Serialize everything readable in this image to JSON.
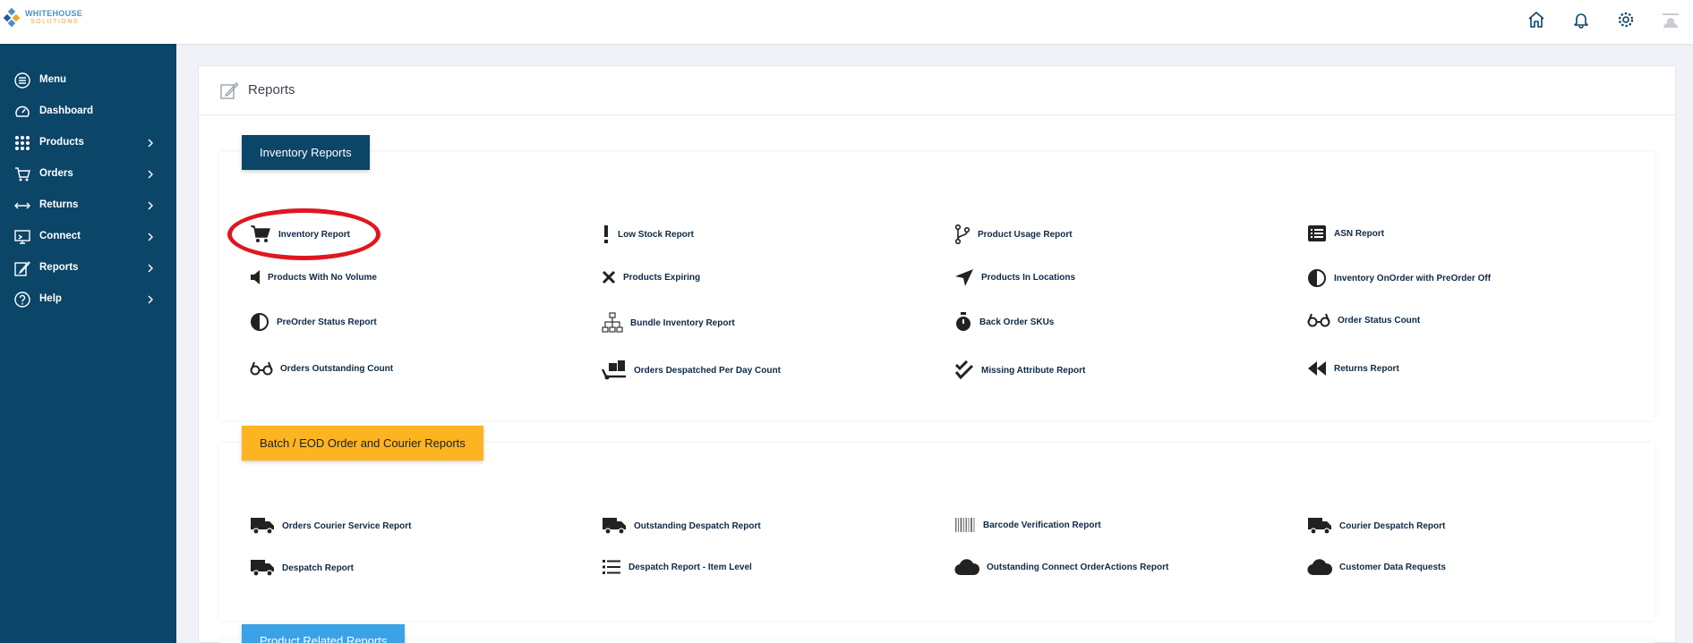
{
  "brand": {
    "name_line1": "WHITEHOUSE",
    "name_line2": "SOLUTIONS"
  },
  "colors": {
    "sidebar": "#0b4568",
    "tab_inventory": "#0b4568",
    "tab_batch": "#fcb420",
    "tab_product": "#3aa3e8",
    "highlight_circle": "#e01620"
  },
  "topbar": {
    "icons": [
      "home-icon",
      "bell-icon",
      "gear-icon",
      "user-avatar"
    ]
  },
  "sidebar": {
    "items": [
      {
        "label": "Menu",
        "icon": "menu-icon",
        "has_chevron": false
      },
      {
        "label": "Dashboard",
        "icon": "dashboard-icon",
        "has_chevron": false
      },
      {
        "label": "Products",
        "icon": "grid-icon",
        "has_chevron": true
      },
      {
        "label": "Orders",
        "icon": "cart-icon",
        "has_chevron": true
      },
      {
        "label": "Returns",
        "icon": "arrows-icon",
        "has_chevron": true
      },
      {
        "label": "Connect",
        "icon": "monitor-icon",
        "has_chevron": true
      },
      {
        "label": "Reports",
        "icon": "edit-icon",
        "has_chevron": true
      },
      {
        "label": "Help",
        "icon": "question-icon",
        "has_chevron": true
      }
    ]
  },
  "page": {
    "title": "Reports"
  },
  "sections": {
    "inventory": {
      "title": "Inventory Reports",
      "reports": [
        {
          "label": "Inventory Report",
          "icon": "cart-icon"
        },
        {
          "label": "Low Stock Report",
          "icon": "exclamation-icon"
        },
        {
          "label": "Product Usage Report",
          "icon": "branch-icon"
        },
        {
          "label": "ASN Report",
          "icon": "list-box-icon"
        },
        {
          "label": "Products With No Volume",
          "icon": "volume-off-icon"
        },
        {
          "label": "Products Expiring",
          "icon": "x-icon"
        },
        {
          "label": "Products In Locations",
          "icon": "location-arrow-icon"
        },
        {
          "label": "Inventory OnOrder with PreOrder Off",
          "icon": "half-circle-icon"
        },
        {
          "label": "PreOrder Status Report",
          "icon": "half-circle-icon"
        },
        {
          "label": "Bundle Inventory Report",
          "icon": "sitemap-icon"
        },
        {
          "label": "Back Order SKUs",
          "icon": "stopwatch-icon"
        },
        {
          "label": "Order Status Count",
          "icon": "glasses-icon"
        },
        {
          "label": "Orders Outstanding Count",
          "icon": "glasses-icon"
        },
        {
          "label": "Orders Despatched Per Day Count",
          "icon": "dolly-icon"
        },
        {
          "label": "Missing Attribute Report",
          "icon": "double-check-icon"
        },
        {
          "label": "Returns Report",
          "icon": "backward-icon"
        }
      ]
    },
    "batch": {
      "title": "Batch / EOD Order and Courier Reports",
      "reports": [
        {
          "label": "Orders Courier Service Report",
          "icon": "truck-icon"
        },
        {
          "label": "Outstanding Despatch Report",
          "icon": "truck-icon"
        },
        {
          "label": "Barcode Verification Report",
          "icon": "barcode-icon"
        },
        {
          "label": "Courier Despatch Report",
          "icon": "truck-icon"
        },
        {
          "label": "Despatch Report",
          "icon": "truck-icon"
        },
        {
          "label": "Despatch Report - Item Level",
          "icon": "list-icon"
        },
        {
          "label": "Outstanding Connect OrderActions Report",
          "icon": "cloud-icon"
        },
        {
          "label": "Customer Data Requests",
          "icon": "cloud-icon"
        }
      ]
    },
    "product": {
      "title": "Product Related Reports"
    }
  }
}
